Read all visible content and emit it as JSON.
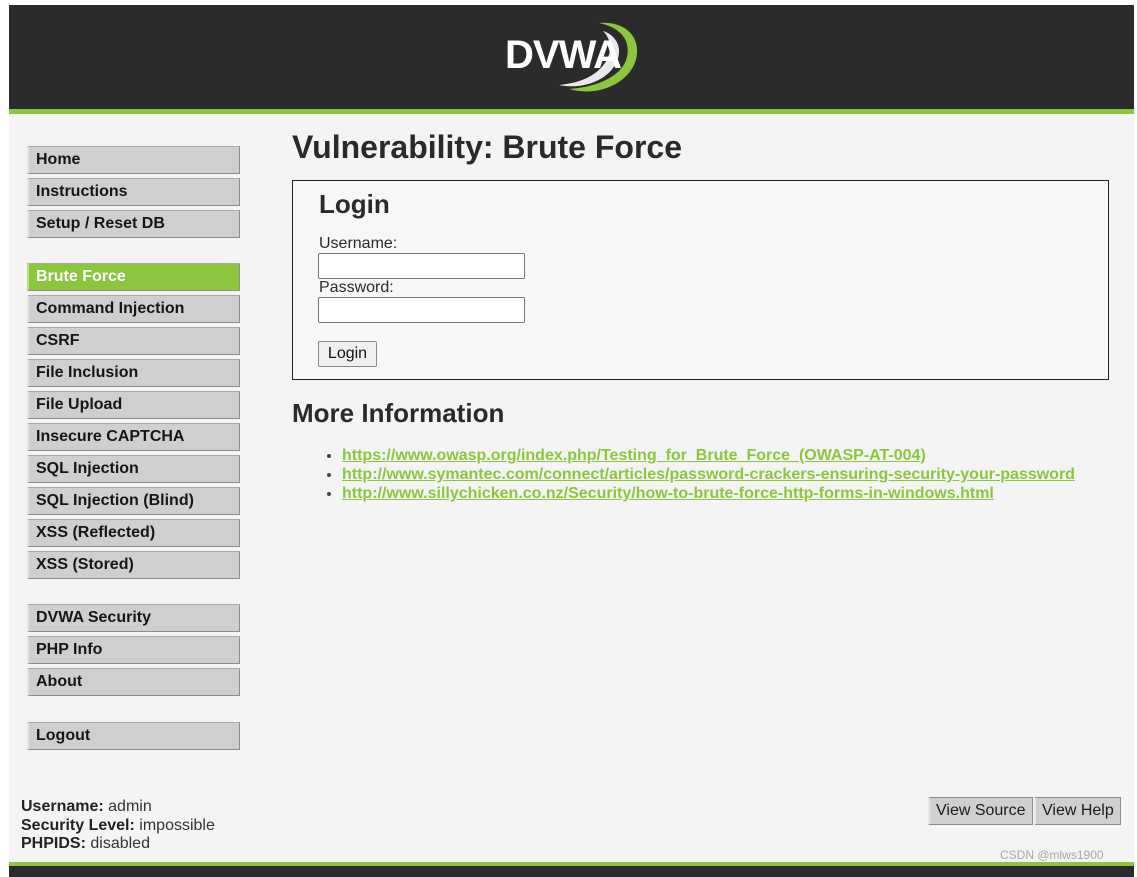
{
  "header": {
    "logo_text": "DVWA",
    "colors": {
      "bar": "#2b2b2b",
      "accent": "#8cc63f"
    }
  },
  "sidebar": {
    "group1": [
      "Home",
      "Instructions",
      "Setup / Reset DB"
    ],
    "group2": [
      "Brute Force",
      "Command Injection",
      "CSRF",
      "File Inclusion",
      "File Upload",
      "Insecure CAPTCHA",
      "SQL Injection",
      "SQL Injection (Blind)",
      "XSS (Reflected)",
      "XSS (Stored)"
    ],
    "group3": [
      "DVWA Security",
      "PHP Info",
      "About"
    ],
    "group4": [
      "Logout"
    ],
    "selected": "Brute Force"
  },
  "main": {
    "title": "Vulnerability: Brute Force",
    "login": {
      "title": "Login",
      "username_label": "Username:",
      "username_value": "",
      "password_label": "Password:",
      "password_value": "",
      "button": "Login"
    },
    "more_info_title": "More Information",
    "links": [
      "https://www.owasp.org/index.php/Testing_for_Brute_Force_(OWASP-AT-004)",
      "http://www.symantec.com/connect/articles/password-crackers-ensuring-security-your-password",
      "http://www.sillychicken.co.nz/Security/how-to-brute-force-http-forms-in-windows.html"
    ]
  },
  "status": {
    "username_label": "Username:",
    "username_value": "admin",
    "security_label": "Security Level:",
    "security_value": "impossible",
    "phpids_label": "PHPIDS:",
    "phpids_value": "disabled"
  },
  "footer": {
    "view_source": "View Source",
    "view_help": "View Help",
    "watermark": "CSDN @mlws1900"
  }
}
